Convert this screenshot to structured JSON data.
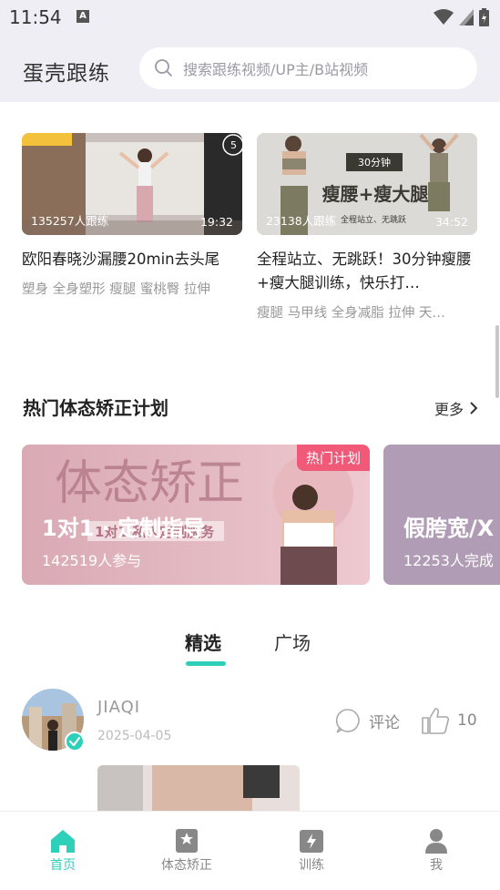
{
  "status_bar": {
    "time": "11:54",
    "notif_icon": "A"
  },
  "header": {
    "app_title": "蛋壳跟练",
    "search_placeholder": "搜索跟练视频/UP主/B站视频"
  },
  "videos": [
    {
      "count": "135257人跟练",
      "duration": "19:32",
      "title": "欧阳春晓沙漏腰20min去头尾",
      "tags": "塑身 全身塑形 瘦腿 蜜桃臀 拉伸"
    },
    {
      "count": "23138人跟练",
      "duration": "34:52",
      "title": "全程站立、无跳跃！30分钟瘦腰+瘦大腿训练，快乐打…",
      "tags": "瘦腿 马甲线 全身减脂 拉伸 天…",
      "thumb_text_1": "30分钟",
      "thumb_text_2": "瘦腰+瘦大腿",
      "thumb_text_3": "全程站立、无跳跃"
    }
  ],
  "plans_section": {
    "title": "热门体态矫正计划",
    "more_label": "更多"
  },
  "plans": [
    {
      "badge": "热门计划",
      "bg_text": "体态矫正",
      "title": "1对1 · 定制指导",
      "overlay": "1对1 私人定制服务",
      "subtitle": "142519人参与"
    },
    {
      "title": "假胯宽/X",
      "subtitle": "12253人完成"
    }
  ],
  "feed_tabs": [
    {
      "label": "精选",
      "active": true
    },
    {
      "label": "广场",
      "active": false
    }
  ],
  "post": {
    "user": "JIAQI",
    "date": "2025-04-05",
    "comment_label": "评论",
    "likes": "10"
  },
  "bottom_nav": [
    {
      "label": "首页",
      "icon": "home-icon",
      "active": true
    },
    {
      "label": "体态矫正",
      "icon": "bookmark-star-icon",
      "active": false
    },
    {
      "label": "训练",
      "icon": "bolt-icon",
      "active": false
    },
    {
      "label": "我",
      "icon": "person-icon",
      "active": false
    }
  ],
  "colors": {
    "accent": "#2ed0b9",
    "badge": "#f05a78",
    "header_bg": "#efeef4"
  }
}
